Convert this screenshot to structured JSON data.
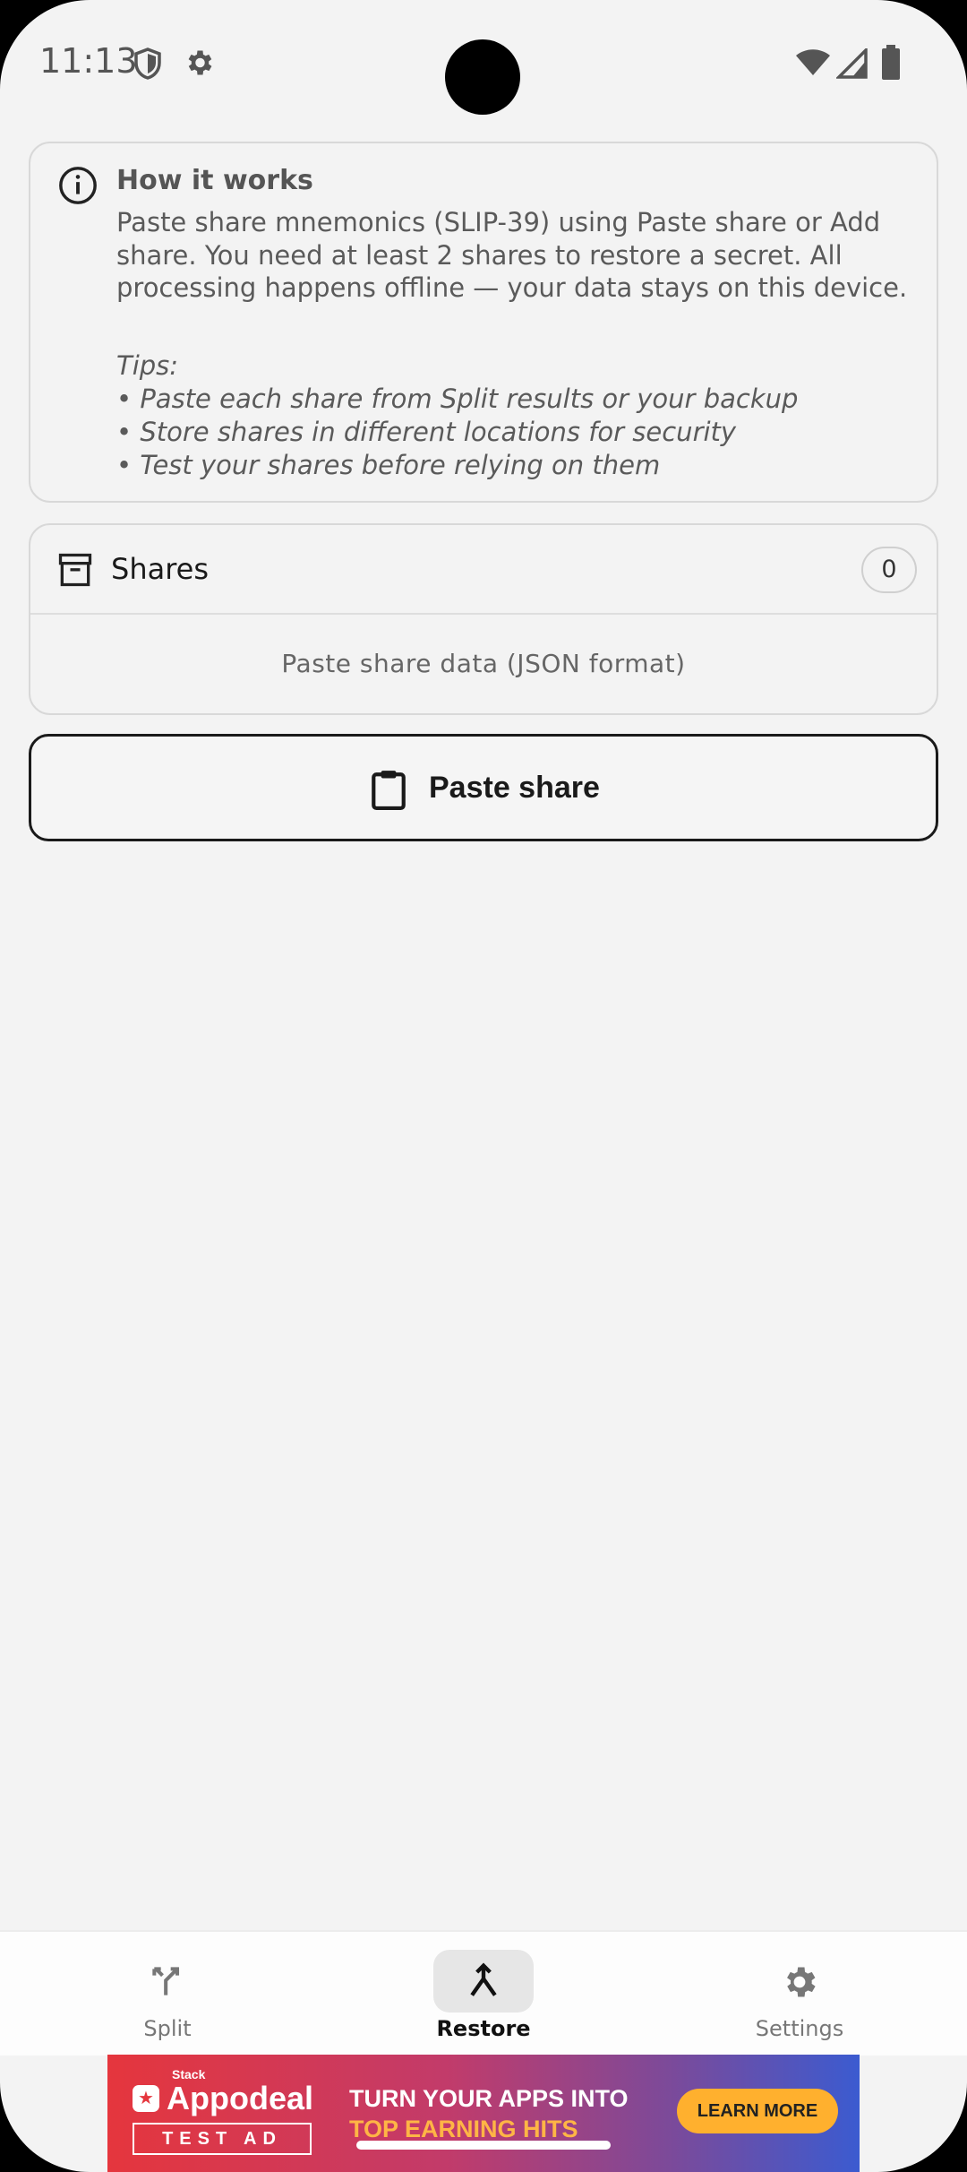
{
  "status_bar": {
    "time": "11:13",
    "icons": [
      "shield-icon",
      "gear-icon",
      "wifi-icon",
      "signal-icon",
      "battery-icon"
    ]
  },
  "info_card": {
    "title": "How it works",
    "body": "Paste share mnemonics (SLIP-39) using Paste share or Add share. You need at least 2 shares to restore a secret. All processing happens offline — your data stays on this device.",
    "tips_heading": "Tips:",
    "tips": [
      "• Paste each share from Split results or your backup",
      "• Store shares in different locations for security",
      "• Test your shares before relying on them"
    ]
  },
  "shares_card": {
    "title": "Shares",
    "count": "0",
    "hint": "Paste share data (JSON format)"
  },
  "paste_button": {
    "label": "Paste share"
  },
  "bottom_nav": {
    "items": [
      {
        "label": "Split",
        "icon": "split-icon",
        "active": false
      },
      {
        "label": "Restore",
        "icon": "merge-icon",
        "active": true
      },
      {
        "label": "Settings",
        "icon": "gear-icon",
        "active": false
      }
    ]
  },
  "ad": {
    "stack": "Stack",
    "brand": "Appodeal",
    "badge": "TEST AD",
    "headline_1": "TURN YOUR APPS INTO",
    "headline_2": "TOP EARNING HITS",
    "cta": "LEARN MORE"
  },
  "colors": {
    "background": "#f3f3f3",
    "text_primary": "#1a1a1a",
    "text_secondary": "#5a5a5a",
    "active_pill": "#e6e6e6",
    "ad_cta": "#ffb02e"
  }
}
